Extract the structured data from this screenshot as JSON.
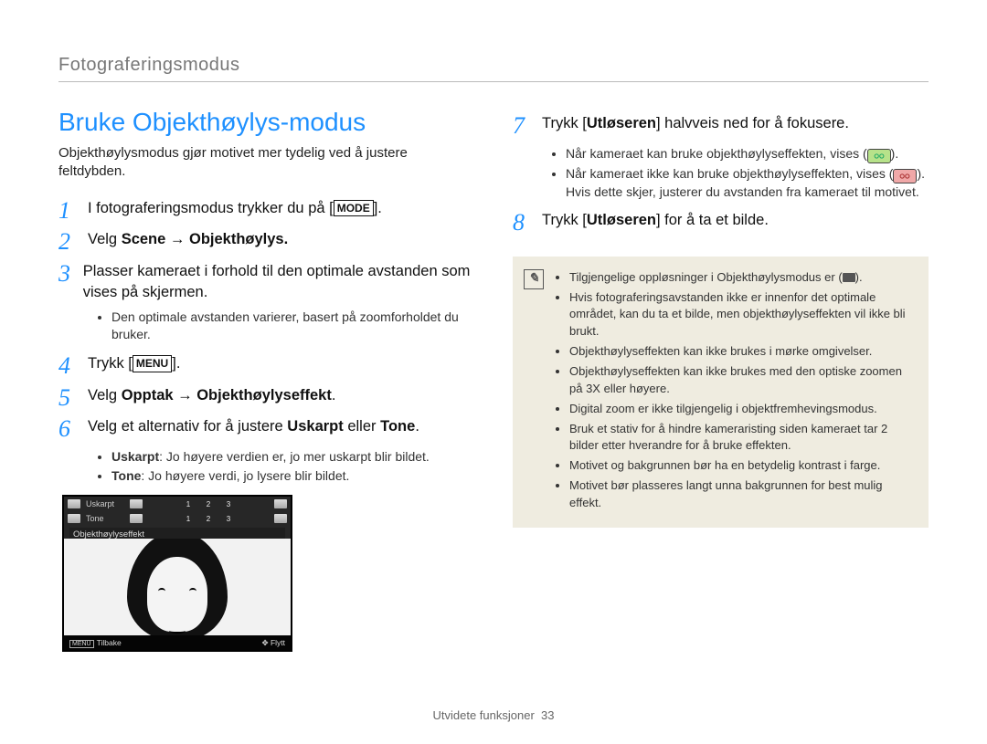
{
  "section_label": "Fotograferingsmodus",
  "title": "Bruke Objekthøylys-modus",
  "intro": "Objekthøylysmodus gjør motivet mer tydelig ved å justere feltdybden.",
  "left_steps": {
    "s1": {
      "num": "1",
      "pre": "I fotograferingsmodus trykker du på [",
      "mode": "MODE",
      "post": "]."
    },
    "s2": {
      "num": "2",
      "pre": "Velg ",
      "bold": "Scene → Objekthøylys.",
      "post": ""
    },
    "s3": {
      "num": "3",
      "text": "Plasser kameraet i forhold til den optimale avstanden som vises på skjermen."
    },
    "s3_bullets": [
      "Den optimale avstanden varierer, basert på zoomforholdet du bruker."
    ],
    "s4": {
      "num": "4",
      "pre": "Trykk [",
      "mode": "MENU",
      "post": "]."
    },
    "s5": {
      "num": "5",
      "pre": "Velg ",
      "bold": "Opptak → Objekthøylyseffekt",
      "post": "."
    },
    "s6": {
      "num": "6",
      "pre": "Velg et alternativ for å justere ",
      "bold1": "Uskarpt",
      "mid": " eller ",
      "bold2": "Tone",
      "post": "."
    },
    "s6_bullets": [
      {
        "label": "Uskarpt",
        "text": ": Jo høyere verdien er, jo mer uskarpt blir bildet."
      },
      {
        "label": "Tone",
        "text": ": Jo høyere verdi, jo lysere blir bildet."
      }
    ]
  },
  "camera_preview": {
    "row1_label": "Uskarpt",
    "row2_label": "Tone",
    "nums": [
      "1",
      "2",
      "3"
    ],
    "subtitle": "Objekthøylyseffekt",
    "bottom_left_label": "MENU",
    "bottom_left": "Tilbake",
    "bottom_right": "Flytt"
  },
  "right_steps": {
    "s7": {
      "num": "7",
      "pre": "Trykk [",
      "bold": "Utløseren",
      "post": "] halvveis ned for å fokusere."
    },
    "s7_bullets": {
      "a_pre": "Når kameraet kan bruke objekthøylyseffekten, vises (",
      "a_post": ").",
      "b_pre": "Når kameraet ikke kan bruke objekthøylyseffekten, vises (",
      "b_post": "). Hvis dette skjer, justerer du avstanden fra kameraet til motivet."
    },
    "s8": {
      "num": "8",
      "pre": "Trykk [",
      "bold": "Utløseren",
      "post": "] for å ta et bilde."
    }
  },
  "note_bullets": {
    "a_pre": "Tilgjengelige oppløsninger i Objekthøylysmodus er (",
    "a_post": ").",
    "b": "Hvis fotograferingsavstanden ikke er innenfor det optimale området, kan du ta et bilde, men objekthøylyseffekten vil ikke bli brukt.",
    "c": "Objekthøylyseffekten kan ikke brukes i mørke omgivelser.",
    "d": "Objekthøylyseffekten kan ikke brukes med den optiske zoomen på 3X eller høyere.",
    "e": "Digital zoom er ikke tilgjengelig i objektfremhevingsmodus.",
    "f": "Bruk et stativ for å hindre kameraristing siden kameraet tar 2 bilder etter hverandre for å bruke effekten.",
    "g": "Motivet og bakgrunnen bør ha en betydelig kontrast i farge.",
    "h": "Motivet bør plasseres langt unna bakgrunnen for best mulig effekt."
  },
  "footer": {
    "label": "Utvidete funksjoner",
    "page": "33"
  }
}
